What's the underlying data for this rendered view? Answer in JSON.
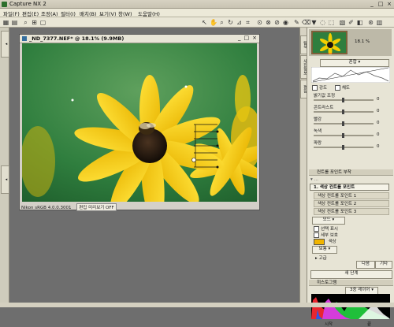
{
  "app": {
    "title": "Capture NX 2",
    "window_buttons": [
      "_",
      "□",
      "×"
    ]
  },
  "menu": [
    "파일(F)",
    "편집(E)",
    "조정(A)",
    "필터(I)",
    "배치(B)",
    "보기(V)",
    "창(W)",
    "도움말(H)"
  ],
  "image_window": {
    "title": "_ND_7377.NEF* @ 18.1% (9.9MB)",
    "status_profile": "Nikon sRGB 4.0.0.3001",
    "status_button": "편집 미리보기 OFF"
  },
  "right_tabs": [
    "탐색",
    "사진정보",
    "편집"
  ],
  "birdseye": {
    "zoom": "18.1"
  },
  "levels": {
    "mode": "혼합",
    "channels": [
      "강도",
      "채도"
    ],
    "rows": [
      {
        "label": "밝기값 조정",
        "value": "0"
      },
      {
        "label": "콘트라스트",
        "value": "0"
      },
      {
        "label": "빨강",
        "value": "0"
      },
      {
        "label": "녹색",
        "value": "0"
      },
      {
        "label": "파랑",
        "value": "0"
      }
    ]
  },
  "layers": {
    "section": "컨트롤 포인트 부착",
    "step_header": "1. 색상 컨트롤 포인트",
    "items": [
      "색상 컨트롤 포인트 1",
      "색상 컨트롤 포인트 2",
      "색상 컨트롤 포인트 3"
    ],
    "method_select": "모드",
    "opt_show": "선택 표시",
    "opt_protect": "세부 보호",
    "color_label": "색상",
    "sub_select": "보통",
    "more": "고급",
    "buttons": [
      "다음",
      "기타"
    ]
  },
  "new_step_button": "새 단계",
  "histogram": {
    "title": "히스토그램",
    "mode": "3중 레이어",
    "footer_left": "시작",
    "footer_right": "끝"
  },
  "colors": {
    "petal": "#f5cf00",
    "bg_green": "#2f7e3e",
    "accent": "#f0b400"
  }
}
